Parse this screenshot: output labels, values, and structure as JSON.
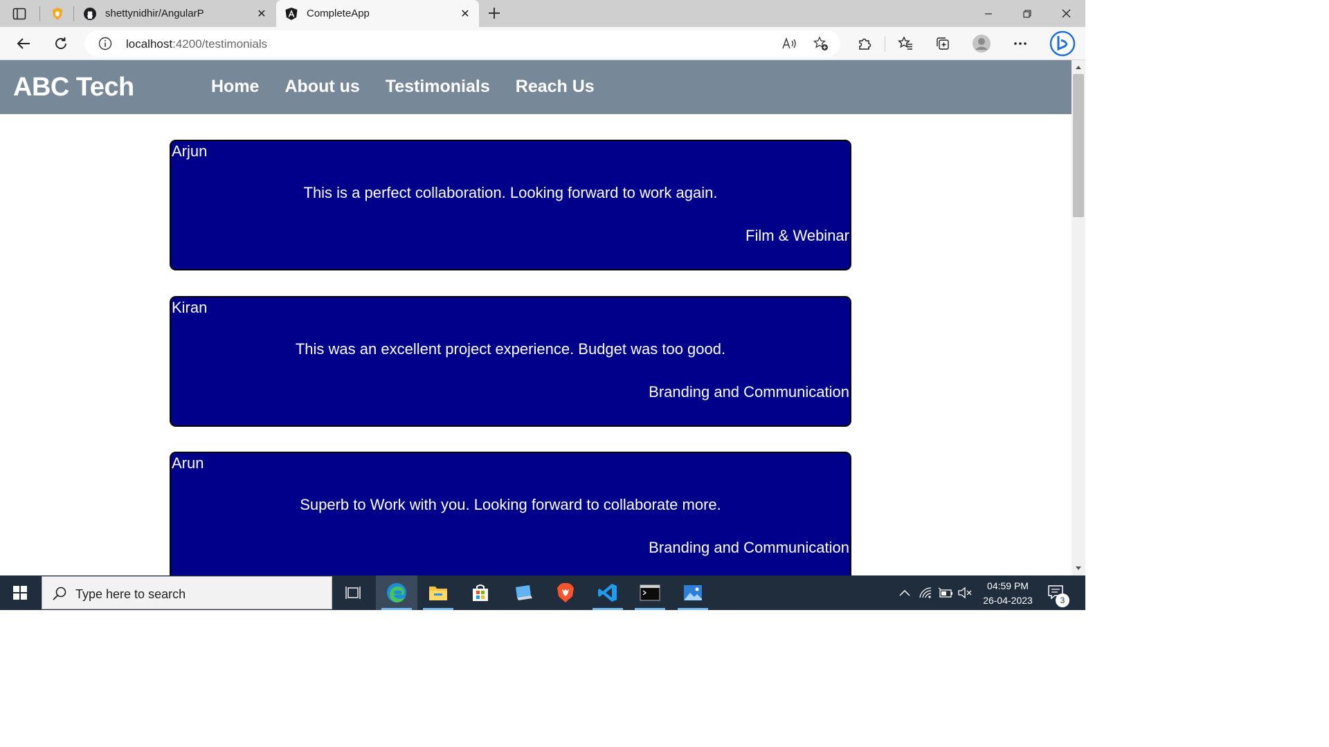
{
  "browser": {
    "tabs": [
      {
        "title": "shettynidhir/AngularP",
        "favicon": "github-icon",
        "active": false
      },
      {
        "title": "CompleteApp",
        "favicon": "angular-icon",
        "active": true
      }
    ],
    "address": {
      "host": "localhost",
      "path": ":4200/testimonials"
    }
  },
  "site": {
    "brand": "ABC Tech",
    "nav": [
      {
        "label": "Home"
      },
      {
        "label": "About us"
      },
      {
        "label": "Testimonials"
      },
      {
        "label": "Reach Us"
      }
    ],
    "colors": {
      "navbar": "#778899",
      "card": "#00008b"
    }
  },
  "testimonials": [
    {
      "name": "Arjun",
      "message": "This is a perfect collaboration. Looking forward to work again.",
      "service": "Film & Webinar"
    },
    {
      "name": "Kiran",
      "message": "This was an excellent project experience. Budget was too good.",
      "service": "Branding and Communication"
    },
    {
      "name": "Arun",
      "message": "Superb to Work with you. Looking forward to collaborate more.",
      "service": "Branding and Communication"
    }
  ],
  "taskbar": {
    "search_placeholder": "Type here to search",
    "apps": [
      "task-view-icon",
      "edge-icon",
      "file-explorer-icon",
      "microsoft-store-icon",
      "remote-desktop-icon",
      "brave-icon",
      "vscode-icon",
      "terminal-icon",
      "photos-icon"
    ],
    "time": "04:59 PM",
    "date": "26-04-2023",
    "notification_count": "3"
  }
}
